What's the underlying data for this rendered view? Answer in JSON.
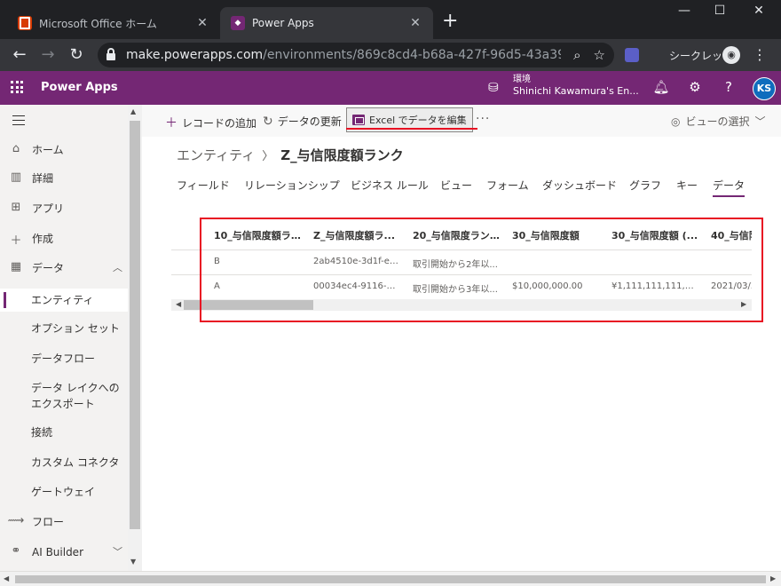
{
  "browser": {
    "tabs": [
      {
        "title": "Microsoft Office ホーム",
        "close": "✕"
      },
      {
        "title": "Power Apps",
        "close": "✕"
      }
    ],
    "new_tab": "+",
    "url_host": "make.powerapps.com",
    "url_path": "/environments/869c8cd4-b68a-427f-96d5-43a39611...",
    "incognito_label": "シークレット"
  },
  "header": {
    "app_name": "Power Apps",
    "env_label": "環境",
    "env_name": "Shinichi Kawamura's En...",
    "avatar": "KS"
  },
  "nav": {
    "items": [
      {
        "label": "ホーム"
      },
      {
        "label": "詳細"
      },
      {
        "label": "アプリ"
      },
      {
        "label": "作成"
      },
      {
        "label": "データ"
      },
      {
        "label": "エンティティ"
      },
      {
        "label": "オプション セット"
      },
      {
        "label": "データフロー"
      },
      {
        "label": "データ レイクへのエクスポート"
      },
      {
        "label": "接続"
      },
      {
        "label": "カスタム コネクタ"
      },
      {
        "label": "ゲートウェイ"
      },
      {
        "label": "フロー"
      },
      {
        "label": "AI Builder"
      }
    ]
  },
  "commands": {
    "add_record": "レコードの追加",
    "refresh": "データの更新",
    "edit_excel": "Excel でデータを編集",
    "more": "···",
    "view_select": "ビューの選択"
  },
  "breadcrumb": {
    "root": "エンティティ",
    "current": "Z_与信限度額ランク"
  },
  "page_tabs": [
    "フィールド",
    "リレーションシップ",
    "ビジネス ルール",
    "ビュー",
    "フォーム",
    "ダッシュボード",
    "グラフ",
    "キー",
    "データ"
  ],
  "grid": {
    "columns": [
      "10_与信限度額ラ...",
      "Z_与信限度額ラ...",
      "20_与信限度ラン...",
      "30_与信限度額",
      "30_与信限度額 (...",
      "40_与信限"
    ],
    "rows": [
      [
        "B",
        "2ab4510e-3d1f-ea1...",
        "取引開始から2年以...",
        "",
        "",
        ""
      ],
      [
        "A",
        "00034ec4-9116-ea1...",
        "取引開始から3年以...",
        "$10,000,000.00",
        "¥1,111,111,111,111",
        "2021/03/3"
      ]
    ]
  },
  "colors": {
    "brand": "#742774",
    "highlight": "#e81123",
    "chrome_dark": "#202124"
  }
}
